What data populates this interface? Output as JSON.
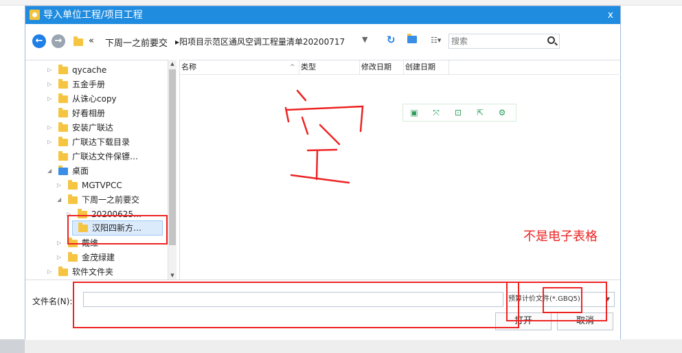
{
  "dialog": {
    "title": "导入单位工程/项目工程",
    "close_glyph": "x"
  },
  "nav": {
    "back_glyph": "←",
    "forward_glyph": "→",
    "chevrons": "«",
    "breadcrumb_1": "下周一之前要交",
    "breadcrumb_2": "▸阳项目示范区通风空调工程量清单20200717",
    "dropdown_glyph": "▼",
    "refresh_glyph": "↻",
    "view_glyph": "☷▾",
    "search_placeholder": "搜索"
  },
  "tree": {
    "items": [
      {
        "label": "qycache",
        "arrow": "▷"
      },
      {
        "label": "五金手册",
        "arrow": "▷"
      },
      {
        "label": "从诛心copy",
        "arrow": "▷"
      },
      {
        "label": "好看相册",
        "arrow": ""
      },
      {
        "label": "安装广联达",
        "arrow": "▷"
      },
      {
        "label": "广联达下载目录",
        "arrow": "▷"
      },
      {
        "label": "广联达文件保镖…",
        "arrow": ""
      },
      {
        "label": "桌面",
        "arrow": "◢"
      },
      {
        "label": "MGTVPCC",
        "arrow": "▷"
      },
      {
        "label": "下周一之前要交",
        "arrow": "◢"
      },
      {
        "label": "20200625…",
        "arrow": "▷"
      },
      {
        "label": "汉阳四新方…",
        "arrow": ""
      },
      {
        "label": "戴维",
        "arrow": "▷"
      },
      {
        "label": "金茂绿建",
        "arrow": "▷"
      },
      {
        "label": "软件文件夹",
        "arrow": "▷"
      }
    ],
    "scroll_up": "▲",
    "scroll_down": "▼"
  },
  "filelist": {
    "columns": [
      "名称",
      "类型",
      "修改日期",
      "创建日期"
    ],
    "sort_glyph": "^",
    "toolbar_icons": [
      "▣",
      "⤧",
      "⊡",
      "⇱",
      "⚙"
    ]
  },
  "bottom": {
    "filename_label": "文件名(N):",
    "filename_value": "",
    "filetype": "预算计价文件(*.GBQ5)",
    "filetype_caret": "▼",
    "open_button": "打开",
    "cancel_button": "取消"
  },
  "annotations": {
    "handwritten": "空",
    "note": "不是电子表格",
    "color": "#ee2222"
  },
  "colors": {
    "titlebar": "#1f8ce0",
    "accent": "#1f7fe6",
    "selection": "#dcebfc"
  }
}
